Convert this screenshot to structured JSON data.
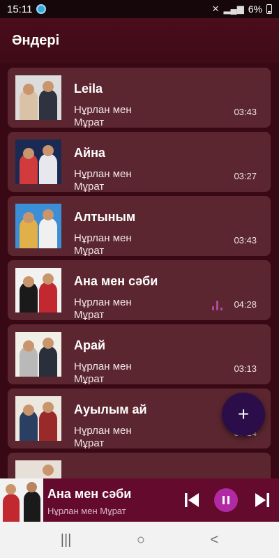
{
  "status_bar": {
    "time": "15:11",
    "battery": "6%"
  },
  "header": {
    "title": "Әндері"
  },
  "songs": [
    {
      "title": "Leila",
      "artist": "Нұрлан мен Мұрат",
      "duration": "03:43",
      "thumb_colors": [
        "#dcdcdc",
        "#2f3340",
        "#d9c2a5"
      ]
    },
    {
      "title": "Айна",
      "artist": "Нұрлан мен Мұрат",
      "duration": "03:27",
      "thumb_colors": [
        "#1b2a55",
        "#e7e7ee",
        "#d23b3b"
      ]
    },
    {
      "title": "Алтыным",
      "artist": "Нұрлан мен Мұрат",
      "duration": "03:43",
      "thumb_colors": [
        "#3c8fd6",
        "#f0f0f0",
        "#e2b04a"
      ]
    },
    {
      "title": "Ана мен сәби",
      "artist": "Нұрлан мен Мұрат",
      "duration": "04:28",
      "thumb_colors": [
        "#f2f2f2",
        "#c1282f",
        "#1a1a1a"
      ],
      "playing": true
    },
    {
      "title": "Арай",
      "artist": "Нұрлан мен Мұрат",
      "duration": "03:13",
      "thumb_colors": [
        "#f0efe8",
        "#2a2f3c",
        "#b9b9b9"
      ]
    },
    {
      "title": "Ауылым ай",
      "artist": "Нұрлан мен Мұрат",
      "duration": "03:14",
      "thumb_colors": [
        "#ece7df",
        "#9a2a2a",
        "#2b3f63"
      ]
    }
  ],
  "fab": {
    "label": "+"
  },
  "mini_player": {
    "title": "Ана мен сәби",
    "artist": "Нұрлан мен Мұрат"
  },
  "colors": {
    "background": "#3e0a14",
    "card": "#5b2630",
    "mini_player": "#640a2c",
    "accent": "#b12aa3",
    "fab": "#2a0d49"
  },
  "icons": {
    "nav_recents": "|||",
    "nav_home": "○",
    "nav_back": "<"
  }
}
